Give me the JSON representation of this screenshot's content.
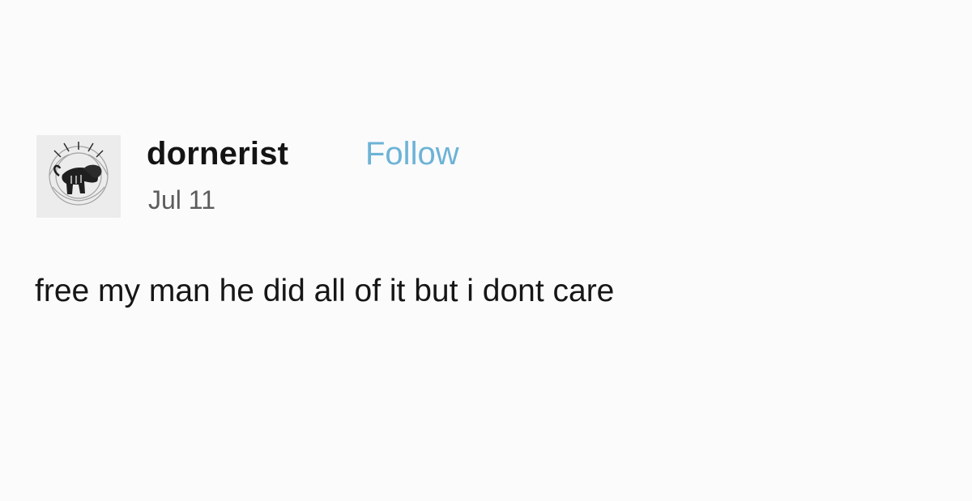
{
  "post": {
    "username": "dornerist",
    "follow_label": "Follow",
    "date": "Jul 11",
    "text": "free my man he did all of it but i dont care"
  },
  "icons": {
    "avatar": "lion-sun-avatar"
  },
  "colors": {
    "follow": "#6db3d6",
    "background": "#fbfbfc",
    "text": "#161616",
    "date": "#5c5c5c"
  }
}
